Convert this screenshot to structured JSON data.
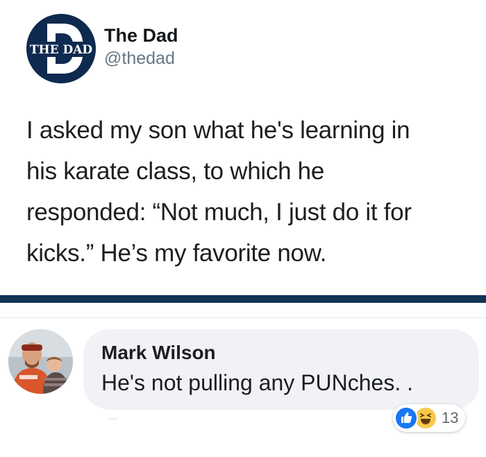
{
  "tweet": {
    "avatar_text": "THE DAD",
    "display_name": "The Dad",
    "handle": "@thedad",
    "text_lines": [
      "I asked my son what he's learning in",
      "his karate class, to which he",
      "responded: “Not much, I just do it for",
      "kicks.” He’s my favorite now."
    ]
  },
  "comment": {
    "author": "Mark Wilson",
    "text": "He's not pulling any PUNches. .",
    "reactions": {
      "icons": [
        "like-icon",
        "haha-icon"
      ],
      "count": "13"
    }
  },
  "colors": {
    "divider": "#123256",
    "avatar_bg": "#0f2a4f",
    "bubble_bg": "#f0f2f5",
    "like": "#1877f2",
    "haha": "#f7c94a"
  }
}
